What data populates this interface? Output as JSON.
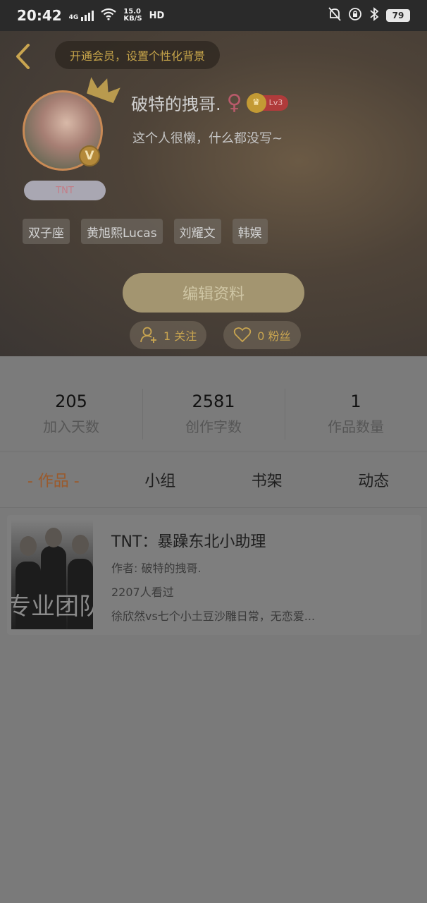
{
  "status_bar": {
    "time": "20:42",
    "net_speed": "15.0",
    "net_unit": "KB/S",
    "network": "4G",
    "hd": "HD",
    "battery": "79"
  },
  "header": {
    "vip_banner": "开通会员，设置个性化背景",
    "username": "破特的拽哥.",
    "gender_symbol": "♀",
    "level": "Lv3",
    "bio": "这个人很懒，什么都没写~",
    "nameplate": "TNT",
    "v_badge": "V",
    "tags": [
      "双子座",
      "黄旭熙Lucas",
      "刘耀文",
      "韩娱"
    ],
    "edit_button": "编辑资料",
    "follow_label": "1 关注",
    "fans_label": "0 粉丝"
  },
  "stats": [
    {
      "value": "205",
      "label": "加入天数"
    },
    {
      "value": "2581",
      "label": "创作字数"
    },
    {
      "value": "1",
      "label": "作品数量"
    }
  ],
  "tabs": [
    "- 作品 -",
    "小组",
    "书架",
    "动态"
  ],
  "works": [
    {
      "title": "TNT：暴躁东北小助理",
      "author": "作者: 破特的拽哥.",
      "views": "2207人看过",
      "summary": "徐欣然vs七个小土豆沙雕日常，无恋爱...",
      "cover_text": "专业团队"
    }
  ],
  "colors": {
    "accent_gold": "#c9a550",
    "active_tab": "#9a5a2c"
  }
}
